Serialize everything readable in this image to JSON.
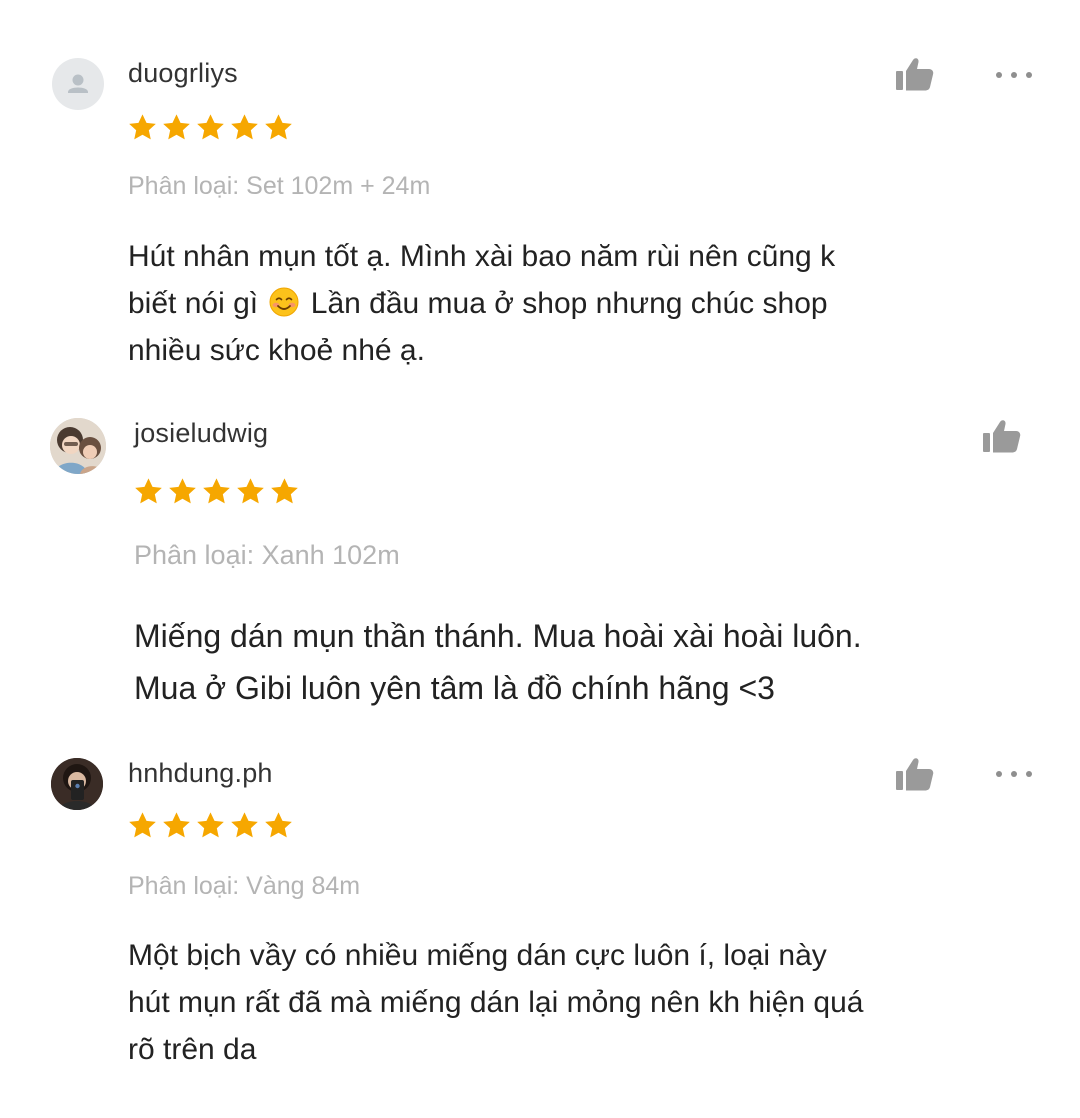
{
  "colors": {
    "star": "#f6a700",
    "icon_gray": "#9a9a9a",
    "variant_text": "#b4b4b4",
    "body_text": "#222222"
  },
  "reviews": [
    {
      "username": "duogrliys",
      "rating": 5,
      "variant": "Phân loại: Set 102m + 24m",
      "comment_lines": [
        "Hút nhân mụn tốt ạ. Mình xài bao năm rùi nên cũng k",
        "biết nói gì",
        "Lần đầu mua ở shop nhưng chúc shop",
        "nhiều sức khoẻ nhé ạ."
      ],
      "emoji": "smiling-face-with-blush",
      "avatar": "default-user-icon"
    },
    {
      "username": "josieludwig",
      "rating": 5,
      "variant": "Phân loại: Xanh 102m",
      "comment_lines": [
        "Miếng dán mụn thần thánh. Mua hoài xài hoài luôn.",
        "Mua ở Gibi luôn yên tâm là đồ chính hãng <3"
      ],
      "avatar": "user-photo"
    },
    {
      "username": "hnhdung.ph",
      "rating": 5,
      "variant": "Phân loại: Vàng 84m",
      "comment_lines": [
        "Một bịch vầy có nhiều miếng dán cực luôn í, loại này",
        "hút mụn rất đã mà miếng dán lại mỏng nên kh hiện quá",
        "rõ trên da"
      ],
      "avatar": "user-photo"
    }
  ]
}
